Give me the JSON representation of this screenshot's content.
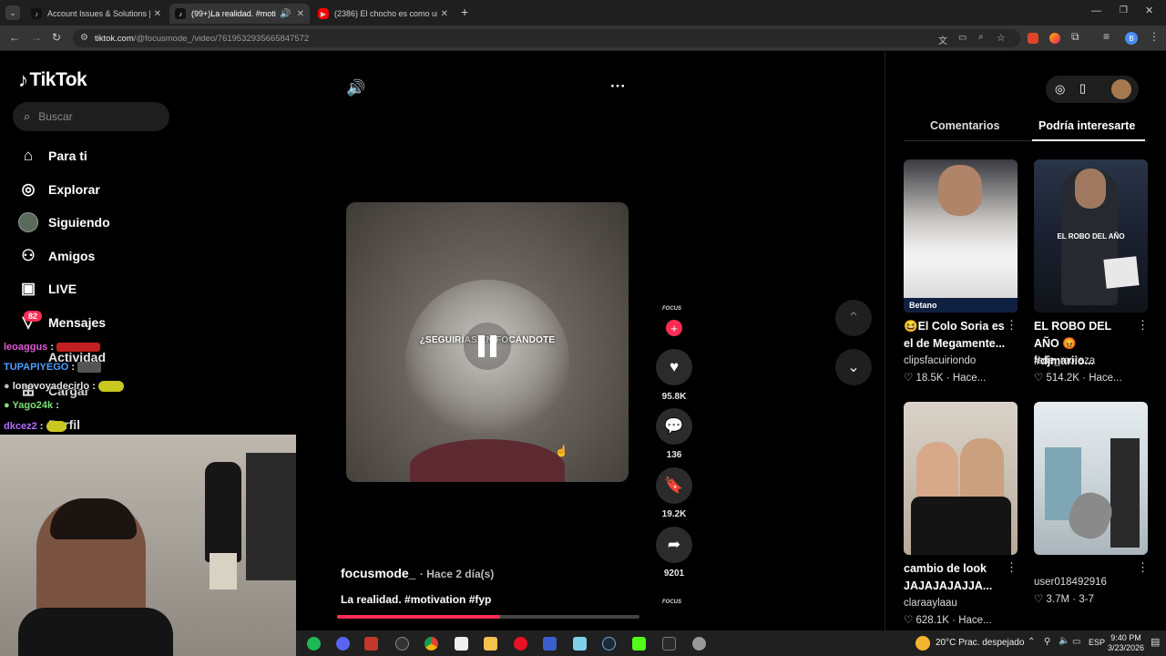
{
  "browser": {
    "tabs": [
      {
        "title": "Account Issues & Solutions | Ti",
        "favicon": "tiktok-icon",
        "active": false
      },
      {
        "title": "(99+)La realidad. #motivati",
        "favicon": "tiktok-icon",
        "active": true
      },
      {
        "title": "(2386) El chocho es como un m",
        "favicon": "youtube-icon",
        "active": false
      }
    ],
    "new_tab": "+",
    "url_host": "tiktok.com",
    "url_path": "/@focusmode_/video/7619532935665847572",
    "profile_letter": "B"
  },
  "sidebar": {
    "logo": "TikTok",
    "search_placeholder": "Buscar",
    "items": [
      {
        "label": "Para ti",
        "icon": "home-icon"
      },
      {
        "label": "Explorar",
        "icon": "compass-icon"
      },
      {
        "label": "Siguiendo",
        "icon": "avatar-icon"
      },
      {
        "label": "Amigos",
        "icon": "friends-icon"
      },
      {
        "label": "LIVE",
        "icon": "live-icon"
      },
      {
        "label": "Mensajes",
        "icon": "message-icon",
        "badge": "82"
      },
      {
        "label": "Actividad",
        "icon": "activity-icon"
      },
      {
        "label": "Cargar",
        "icon": "upload-icon"
      },
      {
        "label": "Perfil",
        "icon": "profile-icon"
      }
    ]
  },
  "chat": [
    {
      "user": "leoaggus",
      "color": "#e05ad0",
      "text": ":"
    },
    {
      "user": "TUPAPIYEGO",
      "color": "#4aa0ff",
      "text": ":"
    },
    {
      "user": "lonovoyadecirlo",
      "color": "#e6e6e6",
      "text": ":"
    },
    {
      "user": "Yago24k",
      "color": "#7be07b",
      "text": ":"
    },
    {
      "user": "dkcez2",
      "color": "#b070ff",
      "text": ":"
    }
  ],
  "video": {
    "caption_overlay": "¿SEGUIRÍAS EN FOCÁNDOTE",
    "author": "focusmode_",
    "posted": "· Hace 2 día(s)",
    "description": "La realidad. #motivation #fyp",
    "brand": "FOCUS",
    "progress": 0.54,
    "actions": [
      {
        "icon": "heart-icon",
        "count": "95.8K"
      },
      {
        "icon": "comment-icon",
        "count": "136"
      },
      {
        "icon": "bookmark-icon",
        "count": "19.2K"
      },
      {
        "icon": "share-icon",
        "count": "9201"
      }
    ]
  },
  "right_panel": {
    "tabs": [
      "Comentarios",
      "Podría interesarte"
    ],
    "active_tab": 1,
    "cards": [
      {
        "title": "😆El Colo Soria es el de Megamente...",
        "author": "clipsfacuiriondo",
        "likes": "18.5K",
        "time": "Hace..."
      },
      {
        "title": "EL ROBO DEL AÑO 😡 #djmariio...",
        "author": "fede_moraza",
        "likes": "514.2K",
        "time": "Hace..."
      },
      {
        "title": "cambio de look JAJAJAJAJJA...",
        "author": "claraaylaau",
        "likes": "628.1K",
        "time": "Hace..."
      },
      {
        "title": "",
        "author": "user018492916",
        "likes": "3.7M",
        "time": "3-7"
      }
    ],
    "thumb_texts": {
      "card2": "EL ROBO DEL AÑO",
      "card1_banner": "Betano"
    }
  },
  "taskbar": {
    "weather": "20°C  Prac. despejado",
    "lang": "ESP",
    "time": "9:40 PM",
    "date": "3/23/2026"
  },
  "colors": {
    "accent": "#fe2c55",
    "bg": "#000000",
    "chrome": "#1f1f1f"
  }
}
